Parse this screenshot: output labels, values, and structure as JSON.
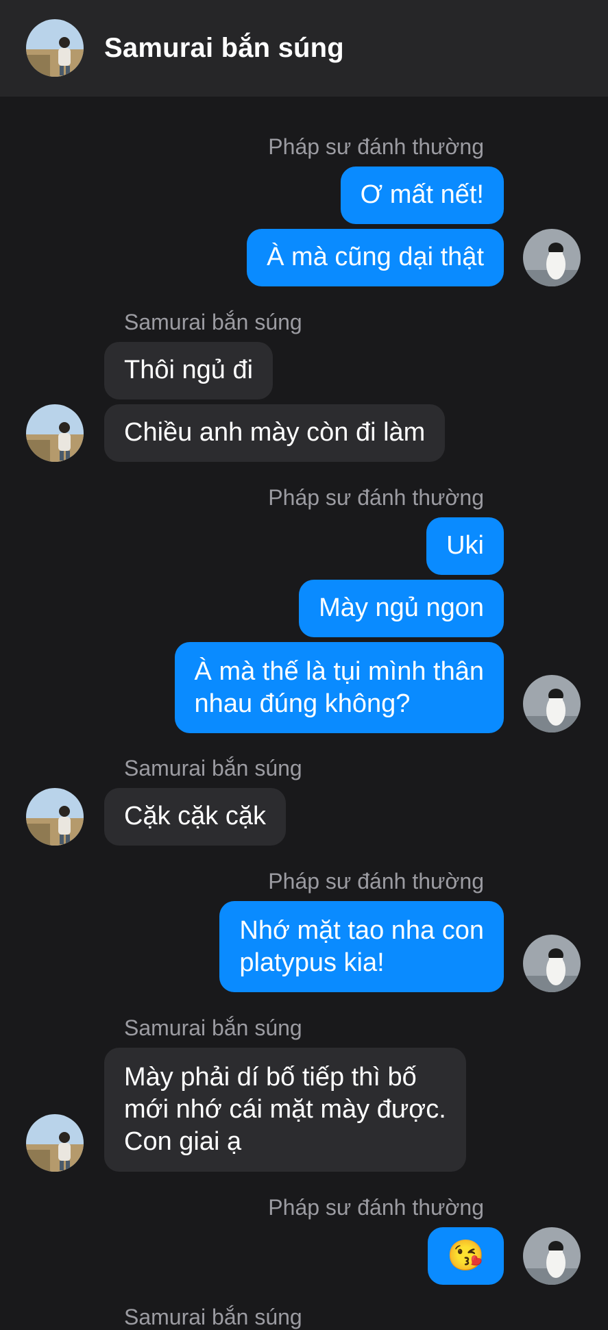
{
  "header": {
    "title": "Samurai bắn súng"
  },
  "contacts": {
    "me": {
      "name": "Pháp sư đánh thường"
    },
    "them": {
      "name": "Samurai bắn súng"
    }
  },
  "messages": [
    {
      "text": "Ơ mất nết!"
    },
    {
      "text": "À mà cũng dại thật"
    },
    {
      "text": "Thôi ngủ đi"
    },
    {
      "text": "Chiều anh mày còn đi làm"
    },
    {
      "text": "Uki"
    },
    {
      "text": "Mày ngủ ngon"
    },
    {
      "line1": "À mà thế là tụi mình thân",
      "line2": "nhau đúng không?"
    },
    {
      "text": "Cặk cặk cặk"
    },
    {
      "line1": "Nhớ mặt tao nha con",
      "line2": "platypus kia!"
    },
    {
      "line1": "Mày phải dí bố tiếp thì bố",
      "line2": "mới nhớ cái mặt mày được.",
      "line3": "Con giai ạ"
    },
    {
      "emoji": "😘"
    }
  ],
  "colors": {
    "outgoing": "#0a8bff",
    "incoming": "#2c2c2f",
    "background": "#19191b"
  }
}
